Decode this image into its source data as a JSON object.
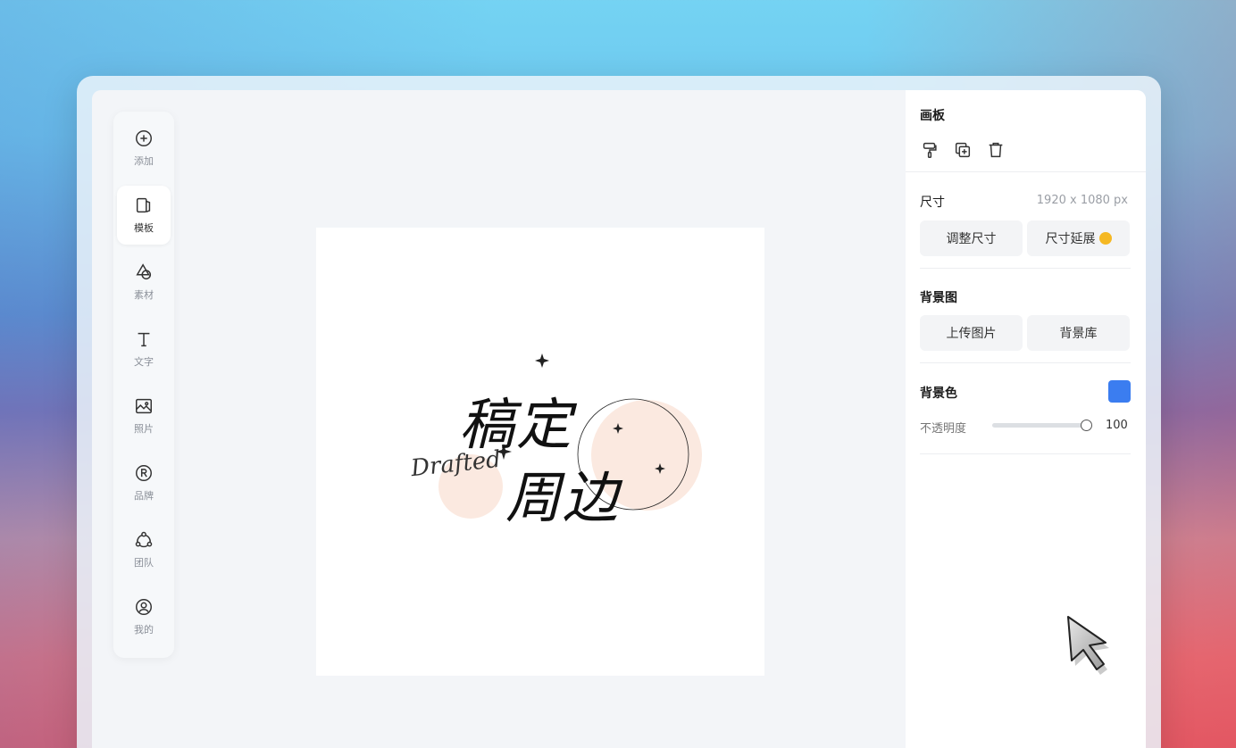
{
  "sidebar": {
    "items": [
      {
        "label": "添加",
        "icon": "plus-circle-icon"
      },
      {
        "label": "模板",
        "icon": "template-icon"
      },
      {
        "label": "素材",
        "icon": "shapes-icon"
      },
      {
        "label": "文字",
        "icon": "text-icon"
      },
      {
        "label": "照片",
        "icon": "image-icon"
      },
      {
        "label": "品牌",
        "icon": "registered-icon"
      },
      {
        "label": "团队",
        "icon": "team-icon"
      },
      {
        "label": "我的",
        "icon": "user-icon"
      }
    ],
    "active_index": 1
  },
  "canvas": {
    "title_line1": "稿定",
    "title_line2": "周边",
    "script_text": "Drafted",
    "accent_color": "#fbe9e0"
  },
  "panel": {
    "artboard": {
      "title": "画板",
      "icons": [
        "paint-roller-icon",
        "duplicate-icon",
        "trash-icon"
      ]
    },
    "size": {
      "title": "尺寸",
      "value": "1920 x 1080 px",
      "resize_label": "调整尺寸",
      "extend_label": "尺寸延展"
    },
    "background_image": {
      "title": "背景图",
      "upload_label": "上传图片",
      "library_label": "背景库"
    },
    "background_color": {
      "title": "背景色",
      "color": "#3b7df0",
      "opacity_label": "不透明度",
      "opacity_value": "100",
      "opacity": 1.0
    }
  }
}
